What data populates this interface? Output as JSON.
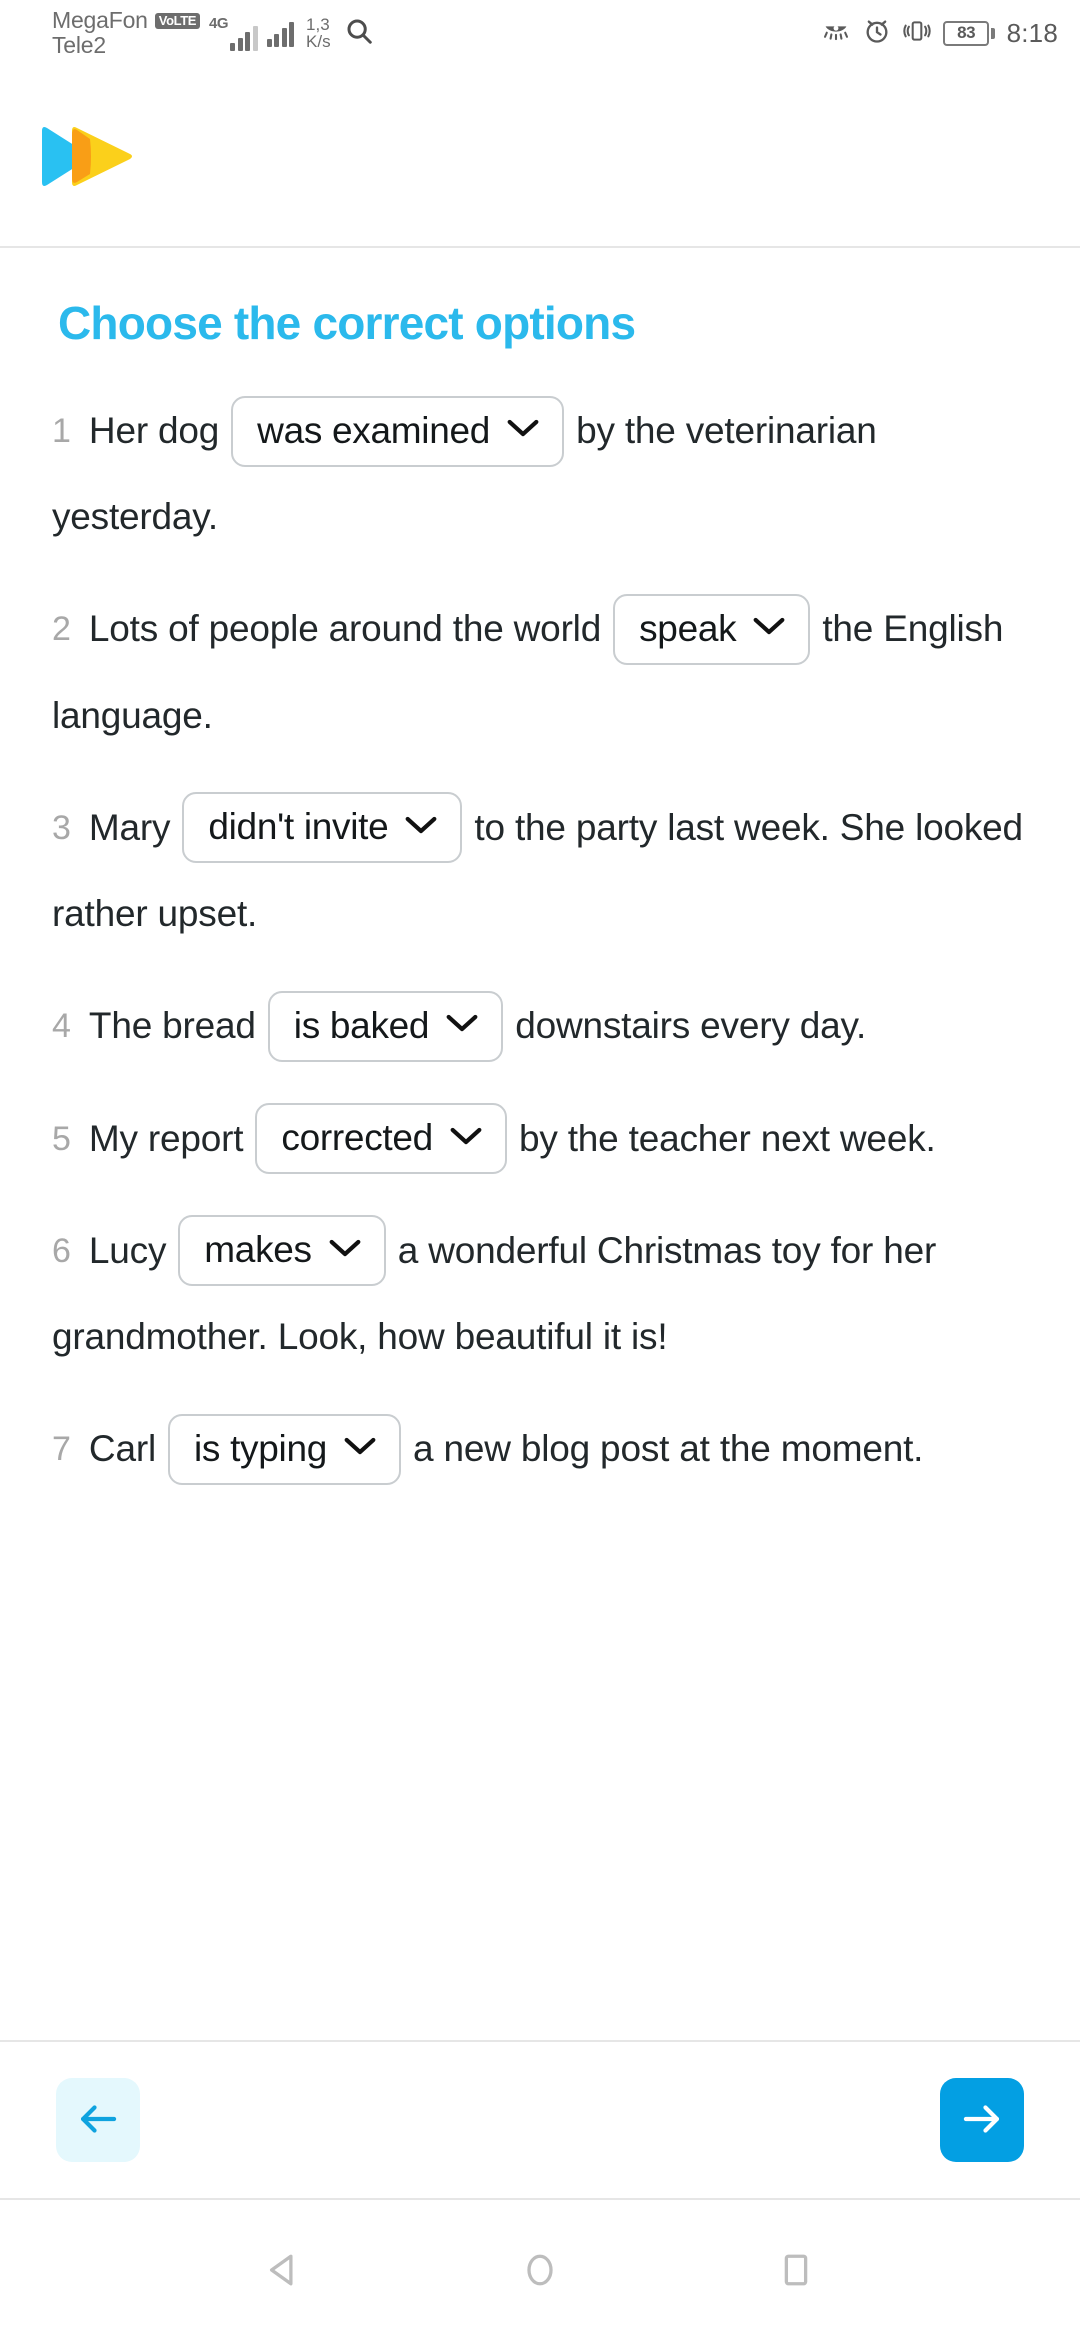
{
  "status_bar": {
    "carrier_primary": "MegaFon",
    "carrier_secondary": "Tele2",
    "volte_badge": "VoLTE",
    "network_type": "4G",
    "net_speed_value": "1,3",
    "net_speed_unit": "K/s",
    "battery_percent": "83",
    "time": "8:18",
    "icons": [
      "search-icon",
      "eye-comfort-icon",
      "alarm-icon",
      "vibrate-icon",
      "battery-icon"
    ]
  },
  "header": {
    "logo_name": "play-logo",
    "logo_colors": {
      "left": "#29C1F2",
      "right": "#FBD01B",
      "overlap": "#F99A16"
    }
  },
  "main": {
    "title": "Choose the correct options",
    "title_color": "#2BB9EC",
    "questions": [
      {
        "number": "1",
        "before": "Her dog",
        "answer": "was examined",
        "after": "by the veterinarian yesterday."
      },
      {
        "number": "2",
        "before": "Lots of people around the world",
        "answer": "speak",
        "after": "the English language."
      },
      {
        "number": "3",
        "before": "Mary",
        "answer": "didn't invite",
        "after": "to the party last week. She looked rather upset."
      },
      {
        "number": "4",
        "before": "The bread",
        "answer": "is baked",
        "after": "downstairs every day."
      },
      {
        "number": "5",
        "before": "My report",
        "answer": "corrected",
        "after": "by the teacher next week."
      },
      {
        "number": "6",
        "before": "Lucy",
        "answer": "makes",
        "after": "a wonderful Christmas toy for her grandmother. Look, how beautiful it is!"
      },
      {
        "number": "7",
        "before": "Carl",
        "answer": "is typing",
        "after": "a new blog post at the moment."
      }
    ]
  },
  "footer": {
    "prev_icon": "arrow-left-icon",
    "next_icon": "arrow-right-icon",
    "prev_bg": "#E4F8FD",
    "next_bg": "#039FE3"
  },
  "system_nav": {
    "back_icon": "triangle-back-icon",
    "home_icon": "circle-home-icon",
    "recents_icon": "square-recents-icon"
  }
}
